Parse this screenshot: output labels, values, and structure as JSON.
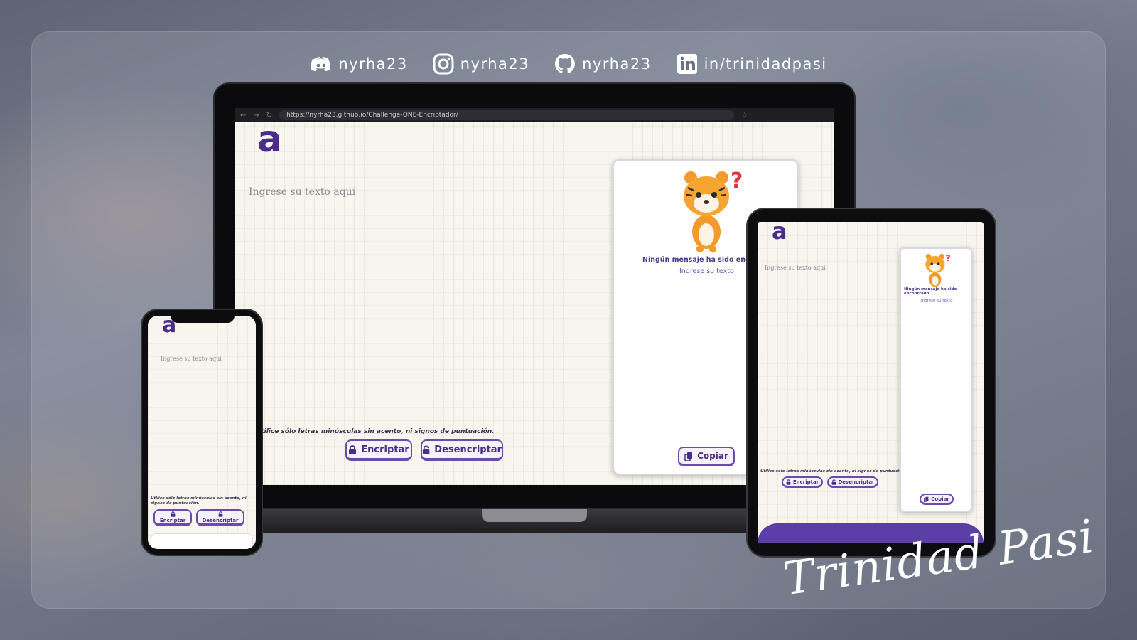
{
  "social": {
    "discord": "nyrha23",
    "instagram": "nyrha23",
    "github": "nyrha23",
    "linkedin": "in/trinidadpasi"
  },
  "laptop": {
    "url": "https://nyrha23.github.io/Challenge-ONE-Encriptador/",
    "logo": "a",
    "input_placeholder": "Ingrese su texto aquí",
    "notice": "Utilice sólo letras minúsculas sin acento, ni signos de puntuación.",
    "encrypt_label": "Encriptar",
    "decrypt_label": "Desencriptar",
    "empty_title": "Ningún mensaje ha sido encontrado",
    "empty_subtitle": "Ingrese su texto",
    "copy_label": "Copiar"
  },
  "phone": {
    "logo": "a",
    "input_placeholder": "Ingrese su texto aquí",
    "notice": "Utilice sólo letras minúsculas sin acento, ni signos de puntuación.",
    "encrypt_label": "Encriptar",
    "decrypt_label": "Desencriptar"
  },
  "tablet": {
    "logo": "a",
    "input_placeholder": "Ingrese su texto aquí",
    "notice": "Utilice sólo letras minúsculas sin acento, ni signos de puntuación.",
    "encrypt_label": "Encriptar",
    "decrypt_label": "Desencriptar",
    "empty_title": "Ningún mensaje ha sido encontrado",
    "empty_subtitle": "Ingrese su texto",
    "copy_label": "Copiar"
  },
  "signature": "Trinidad Pasi",
  "colors": {
    "accent": "#4b2c8c",
    "button_border": "#6a4bb0",
    "tablet_footer": "#5b3ea6",
    "page_bg": "#f8f5ef"
  }
}
